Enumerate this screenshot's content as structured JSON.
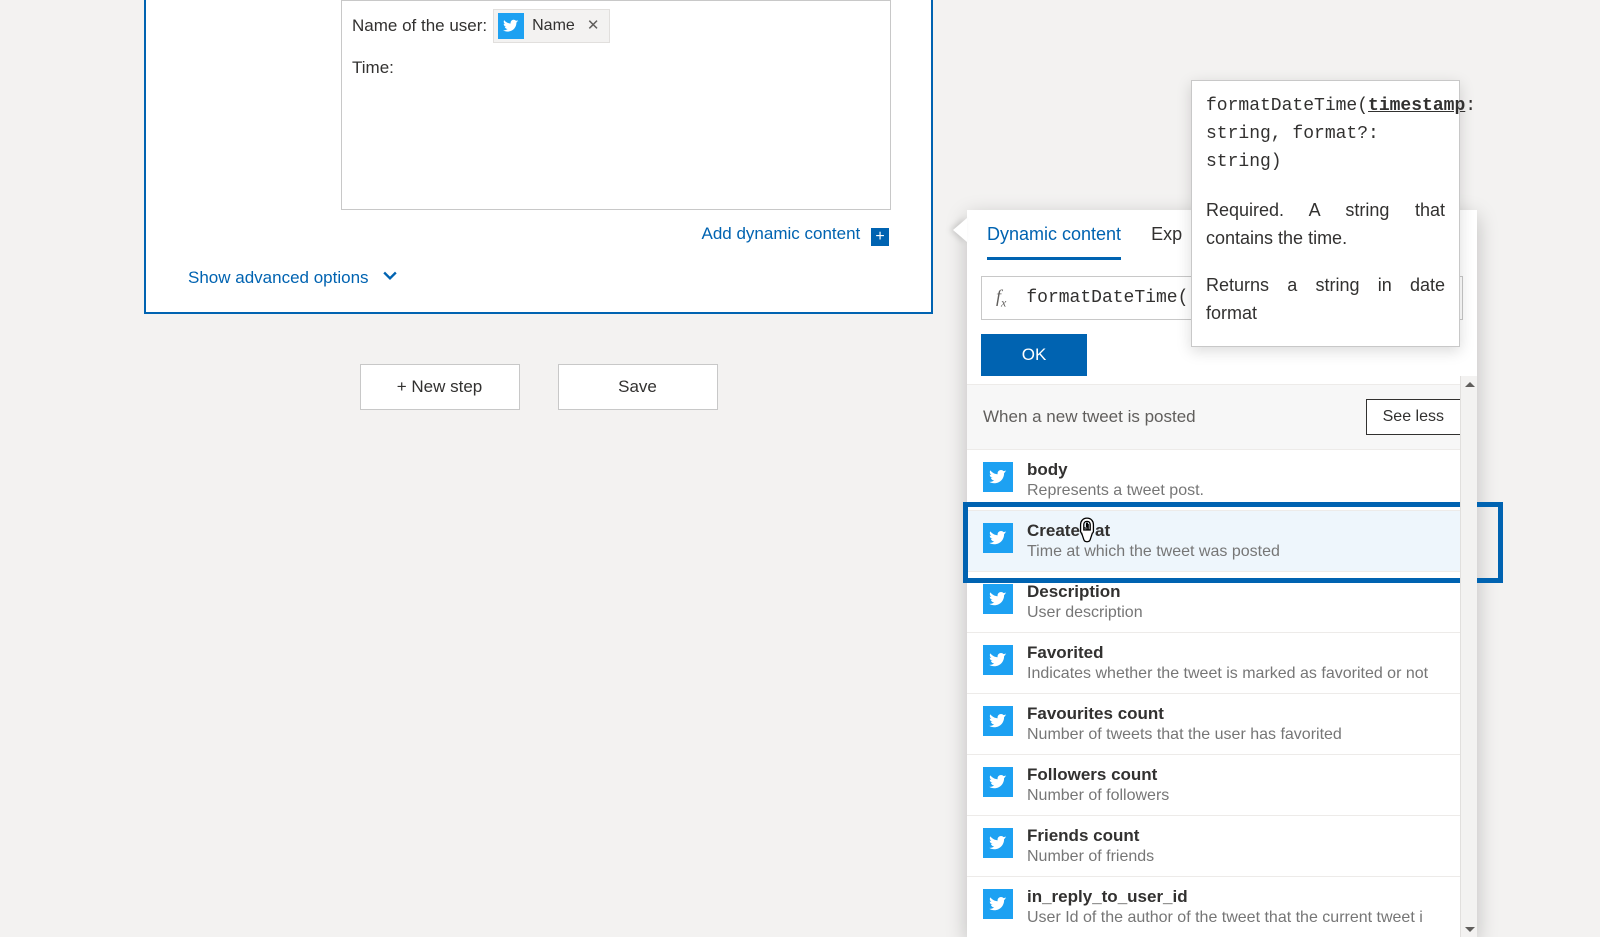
{
  "card": {
    "field1_label": "Name of the user:",
    "field1_token": "Name",
    "field2_label": "Time:",
    "add_dynamic": "Add dynamic content",
    "advanced": "Show advanced options"
  },
  "buttons": {
    "new_step": "+ New step",
    "save": "Save"
  },
  "panel": {
    "tab_dynamic": "Dynamic content",
    "tab_expression": "Exp",
    "expression": "formatDateTime(",
    "ok": "OK",
    "section": "When a new tweet is posted",
    "see_less": "See less",
    "items": [
      {
        "name": "body",
        "desc": "Represents a tweet post."
      },
      {
        "name": "Created at",
        "desc": "Time at which the tweet was posted"
      },
      {
        "name": "Description",
        "desc": "User description"
      },
      {
        "name": "Favorited",
        "desc": "Indicates whether the tweet is marked as favorited or not"
      },
      {
        "name": "Favourites count",
        "desc": "Number of tweets that the user has favorited"
      },
      {
        "name": "Followers count",
        "desc": "Number of followers"
      },
      {
        "name": "Friends count",
        "desc": "Number of friends"
      },
      {
        "name": "in_reply_to_user_id",
        "desc": "User Id of the author of the tweet that the current tweet i"
      }
    ]
  },
  "tooltip": {
    "sig_fn": "formatDateTime(",
    "sig_param": "timestamp",
    "sig_tail": ": string, format?: string)",
    "para1": "Required. A string that contains the time.",
    "para2": "Returns a string in date format"
  }
}
